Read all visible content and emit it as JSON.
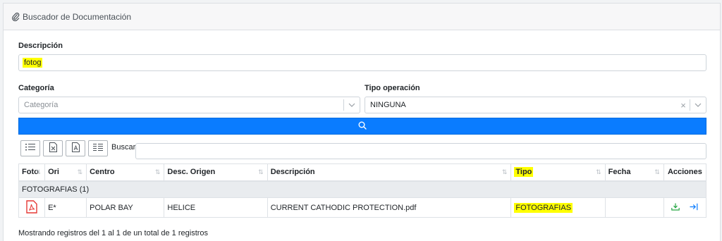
{
  "panel": {
    "title": "Buscador de Documentación",
    "icon": "paperclip-icon"
  },
  "form": {
    "descripcion": {
      "label": "Descripción",
      "value": "fotog"
    },
    "categoria": {
      "label": "Categoría",
      "placeholder": "Categoría"
    },
    "tipo_operacion": {
      "label": "Tipo operación",
      "value": "NINGUNA"
    },
    "search_button_icon": "search-icon"
  },
  "toolbar": {
    "buttons": [
      "list-icon",
      "excel-icon",
      "pdf-icon",
      "columns-icon"
    ],
    "buscar_label": "Buscar:",
    "buscar_value": ""
  },
  "table": {
    "columns": [
      "Foto",
      "Ori",
      "Centro",
      "Desc. Origen",
      "Descripción",
      "Tipo",
      "Fecha",
      "Acciones"
    ],
    "group_label": "FOTOGRAFIAS (1)",
    "rows": [
      {
        "foto_icon": "pdf-file-icon",
        "ori": "E*",
        "centro": "POLAR BAY",
        "desc_origen": "HELICE",
        "descripcion": "CURRENT CATHODIC PROTECTION.pdf",
        "tipo": "FOTOGRAFIAS",
        "fecha": "",
        "acciones": [
          "download-icon",
          "open-icon"
        ]
      }
    ]
  },
  "footer": {
    "info": "Mostrando registros del 1 al 1 de un total de 1 registros"
  },
  "colors": {
    "primary": "#0a7cff",
    "highlight": "#ffff00",
    "pdf": "#e53935",
    "download": "#28a745"
  }
}
